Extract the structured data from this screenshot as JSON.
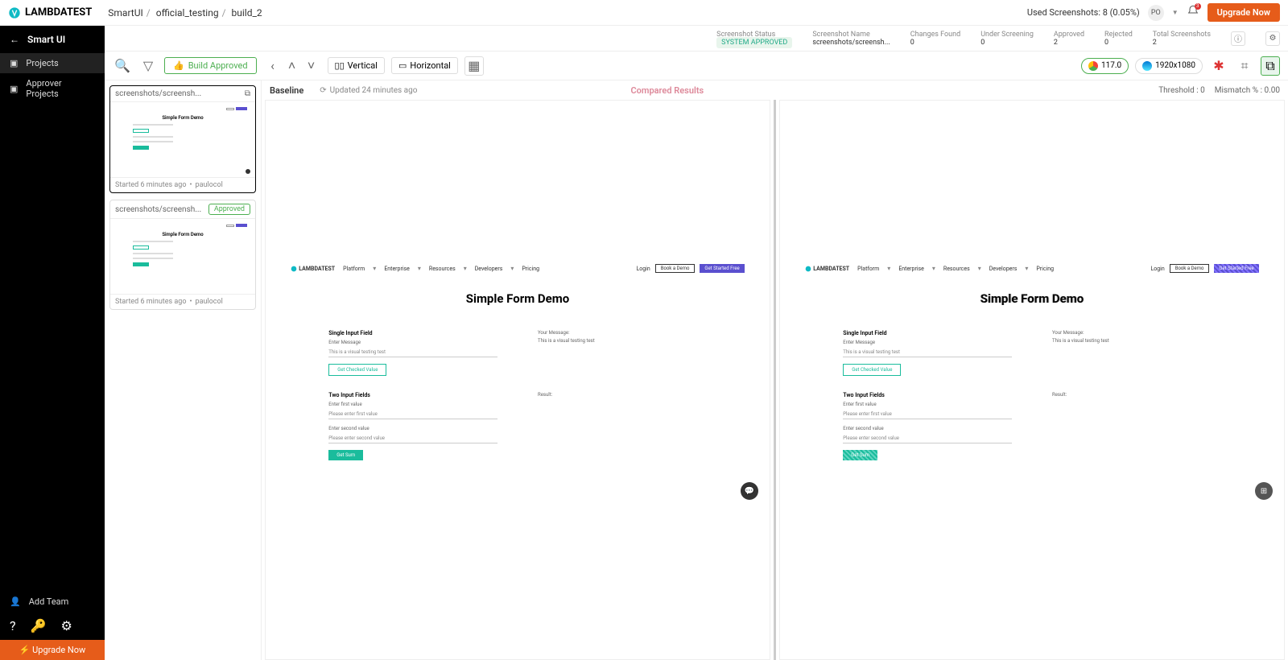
{
  "brand": "LAMBDATEST",
  "breadcrumb": {
    "a": "SmartUI",
    "b": "official_testing",
    "c": "build_2"
  },
  "header": {
    "used_screenshots": "Used Screenshots: 8 (0.05%)",
    "avatar": "PO",
    "notif_count": "3",
    "upgrade": "Upgrade Now"
  },
  "sidebar": {
    "title": "Smart UI",
    "projects": "Projects",
    "approver": "Approver Projects",
    "add_team": "Add Team",
    "upgrade": "Upgrade Now"
  },
  "stats": {
    "status_label": "Screenshot Status",
    "status_value": "SYSTEM APPROVED",
    "name_label": "Screenshot Name",
    "name_value": "screenshots/screensh...",
    "changes_label": "Changes Found",
    "changes_value": "0",
    "screening_label": "Under Screening",
    "screening_value": "0",
    "approved_label": "Approved",
    "approved_value": "2",
    "rejected_label": "Rejected",
    "rejected_value": "0",
    "total_label": "Total Screenshots",
    "total_value": "2"
  },
  "toolbar": {
    "build_approved": "Build Approved",
    "vertical": "Vertical",
    "horizontal": "Horizontal",
    "chrome_ver": "117.0",
    "resolution": "1920x1080"
  },
  "thumbs": [
    {
      "name": "screenshots/screensh...",
      "badge": "",
      "started": "Started 6 minutes ago",
      "author": "paulocol"
    },
    {
      "name": "screenshots/screensh...",
      "badge": "Approved",
      "started": "Started 6 minutes ago",
      "author": "paulocol"
    }
  ],
  "compare": {
    "baseline": "Baseline",
    "updated": "Updated 24 minutes ago",
    "compared": "Compared Results",
    "threshold_label": "Threshold :",
    "threshold_value": "0",
    "mismatch_label": "Mismatch % :",
    "mismatch_value": "0.00"
  },
  "mock": {
    "brand": "LAMBDATEST",
    "nav": {
      "platform": "Platform",
      "enterprise": "Enterprise",
      "resources": "Resources",
      "developers": "Developers",
      "pricing": "Pricing",
      "login": "Login",
      "book": "Book a Demo",
      "cta": "Get Started Free"
    },
    "title": "Simple Form Demo",
    "section1": "Single Input Field",
    "enter_msg": "Enter Message",
    "sample": "This is a visual testing test",
    "btn1": "Get Checked Value",
    "your_msg": "Your Message:",
    "section2": "Two Input Fields",
    "first": "Enter first value",
    "first_ph": "Please enter first value",
    "second": "Enter second value",
    "second_ph": "Please enter second value",
    "btn2": "Get Sum",
    "result": "Result:"
  }
}
